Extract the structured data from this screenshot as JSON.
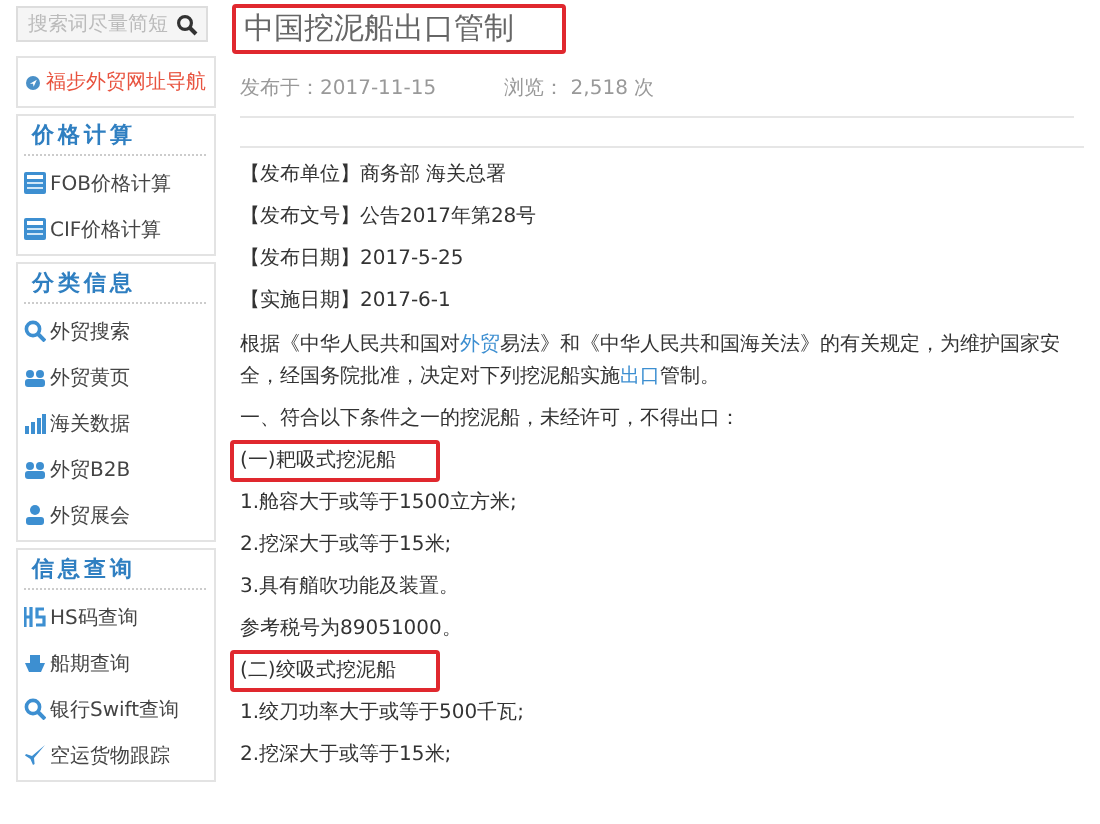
{
  "sidebar": {
    "search": {
      "placeholder": "搜索词尽量简短"
    },
    "nav_link": {
      "label": "福步外贸网址导航"
    },
    "panels": [
      {
        "title": "价格计算",
        "items": [
          {
            "label": "FOB价格计算"
          },
          {
            "label": "CIF价格计算"
          }
        ]
      },
      {
        "title": "分类信息",
        "items": [
          {
            "label": "外贸搜索"
          },
          {
            "label": "外贸黄页"
          },
          {
            "label": "海关数据"
          },
          {
            "label": "外贸B2B"
          },
          {
            "label": "外贸展会"
          }
        ]
      },
      {
        "title": "信息查询",
        "items": [
          {
            "label": "HS码查询"
          },
          {
            "label": "船期查询"
          },
          {
            "label": "银行Swift查询"
          },
          {
            "label": "空运货物跟踪"
          }
        ]
      }
    ]
  },
  "article": {
    "title": "中国挖泥船出口管制",
    "title_boxed": true,
    "published": "发布于：2017-11-15",
    "views": "浏览： 2,518 次",
    "body": [
      {
        "kind": "field",
        "label": "【发布单位】",
        "text": "商务部 海关总署"
      },
      {
        "kind": "field",
        "label": "【发布文号】",
        "text": "公告2017年第28号"
      },
      {
        "kind": "field",
        "label": "【发布日期】",
        "text": "2017-5-25"
      },
      {
        "kind": "field",
        "label": "【实施日期】",
        "text": "2017-6-1"
      },
      {
        "kind": "para",
        "segments": [
          {
            "text": "根据《中华人民共和国对",
            "link": false
          },
          {
            "text": "外贸",
            "link": true
          },
          {
            "text": "易法》和《中华人民共和国海关法》的有关规定，为维护国家安全，经国务院批准，决定对下列挖泥船实施",
            "link": false
          },
          {
            "text": "出口",
            "link": true
          },
          {
            "text": "管制。",
            "link": false
          }
        ]
      },
      {
        "kind": "text",
        "text": "一、符合以下条件之一的挖泥船，未经许可，不得出口：",
        "boxed": false
      },
      {
        "kind": "text",
        "text": "(一)耙吸式挖泥船",
        "boxed": true
      },
      {
        "kind": "text",
        "text": "1.舱容大于或等于1500立方米;",
        "boxed": false
      },
      {
        "kind": "text",
        "text": "2.挖深大于或等于15米;",
        "boxed": false
      },
      {
        "kind": "text",
        "text": "3.具有艏吹功能及装置。",
        "boxed": false
      },
      {
        "kind": "text",
        "text": "参考税号为89051000。",
        "boxed": false
      },
      {
        "kind": "text",
        "text": "(二)绞吸式挖泥船",
        "boxed": true
      },
      {
        "kind": "text",
        "text": "1.绞刀功率大于或等于500千瓦;",
        "boxed": false
      },
      {
        "kind": "text",
        "text": "2.挖深大于或等于15米;",
        "boxed": false
      }
    ]
  }
}
